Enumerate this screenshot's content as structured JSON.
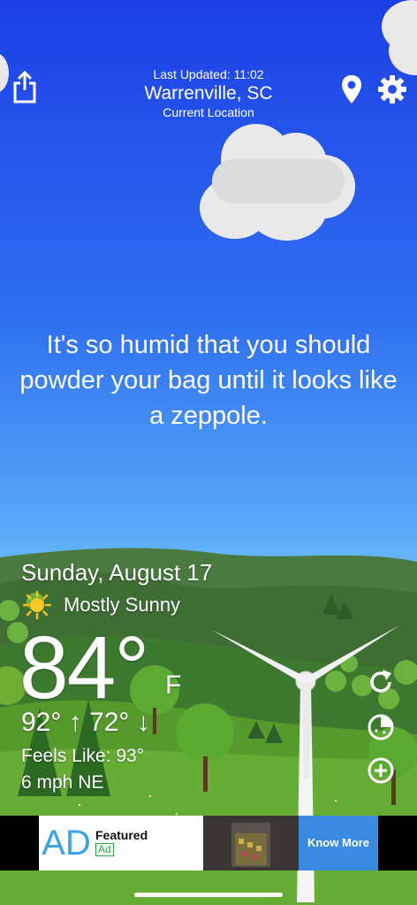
{
  "header": {
    "last_updated": "Last Updated: 11:02",
    "location": "Warrenville, SC",
    "current_location": "Current Location"
  },
  "quote": "It's so humid that you should powder your bag until it looks like a zeppole.",
  "weather": {
    "date": "Sunday, August 17",
    "condition": "Mostly Sunny",
    "temperature": "84°",
    "unit": "F",
    "high_low": "92° ↑  72° ↓",
    "feels_like": "Feels Like: 93°",
    "wind": "6 mph NE"
  },
  "ad": {
    "logo_text": "AD",
    "featured": "Featured",
    "badge": "Ad",
    "cta": "Know More"
  },
  "icons": {
    "share": "share-icon",
    "location": "location-pin-icon",
    "settings": "gear-icon",
    "refresh": "refresh-icon",
    "radar": "radar-icon",
    "add": "add-icon"
  },
  "colors": {
    "sky_top": "#1d3fe6",
    "sky_bottom": "#78c4fb",
    "grass": "#5a9b2f",
    "ad_cta": "#3b8ae2"
  }
}
